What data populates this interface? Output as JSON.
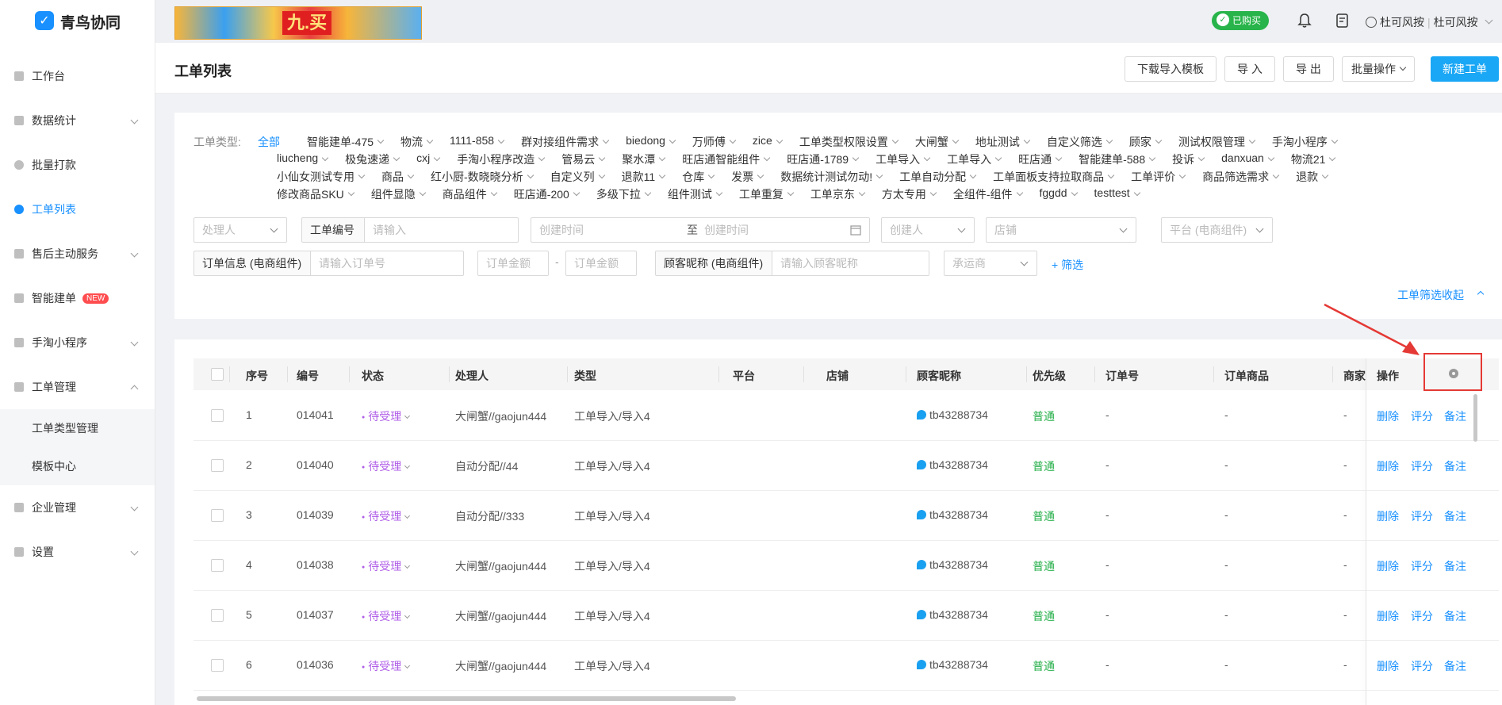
{
  "app": {
    "name": "青鸟协同",
    "logo_mark": "✓"
  },
  "banner": {
    "text": "九.买"
  },
  "header": {
    "purchased_label": "已购买",
    "user_name": "杜可风按",
    "company_name": "杜可风按",
    "separator": "|"
  },
  "sidebar": {
    "items": [
      {
        "label": "工作台",
        "icon": "workbench-icon"
      },
      {
        "label": "数据统计",
        "icon": "chart-icon"
      },
      {
        "label": "批量打款",
        "icon": "payment-icon"
      },
      {
        "label": "工单列表",
        "icon": "search-icon"
      },
      {
        "label": "售后主动服务",
        "icon": "service-icon"
      },
      {
        "label": "智能建单",
        "icon": "smart-icon",
        "badge": "NEW"
      },
      {
        "label": "手淘小程序",
        "icon": "miniapp-icon"
      },
      {
        "label": "工单管理",
        "icon": "ticket-icon"
      },
      {
        "label": "企业管理",
        "icon": "company-icon"
      },
      {
        "label": "设置",
        "icon": "settings-icon"
      }
    ],
    "sub_items": [
      "工单类型管理",
      "模板中心"
    ]
  },
  "page": {
    "title": "工单列表",
    "buttons": {
      "download_template": "下载导入模板",
      "import": "导 入",
      "export": "导 出",
      "batch": "批量操作",
      "create": "新建工单"
    }
  },
  "filters": {
    "type_label": "工单类型:",
    "type_rows": [
      [
        "全部",
        "智能建单-475",
        "物流",
        "1111-858",
        "群对接组件需求",
        "biedong",
        "万师傅",
        "zice",
        "工单类型权限设置",
        "大闸蟹",
        "地址测试",
        "自定义筛选",
        "顾家",
        "测试权限管理",
        "手淘小程序"
      ],
      [
        "liucheng",
        "极兔速递",
        "cxj",
        "手淘小程序改造",
        "管易云",
        "聚水潭",
        "旺店通智能组件",
        "旺店通-1789",
        "工单导入",
        "工单导入",
        "旺店通",
        "智能建单-588",
        "投诉",
        "danxuan",
        "物流21"
      ],
      [
        "小仙女测试专用",
        "商品",
        "红小厨-数晓晓分析",
        "自定义列",
        "退款11",
        "仓库",
        "发票",
        "数据统计测试勿动!",
        "工单自动分配",
        "工单面板支持拉取商品",
        "工单评价",
        "商品筛选需求",
        "退款"
      ],
      [
        "修改商品SKU",
        "组件显隐",
        "商品组件",
        "旺店通-200",
        "多级下拉",
        "组件测试",
        "工单重复",
        "工单京东",
        "方太专用",
        "全组件-组件",
        "fggdd",
        "testtest"
      ]
    ],
    "handler_placeholder": "处理人",
    "ticket_no_label": "工单编号",
    "ticket_no_placeholder": "请输入",
    "created_from_placeholder": "创建时间",
    "date_sep": "至",
    "created_to_placeholder": "创建时间",
    "creator_placeholder": "创建人",
    "shop_placeholder": "店铺",
    "platform_placeholder": "平台 (电商组件)",
    "order_label": "订单信息 (电商组件)",
    "order_placeholder": "请输入订单号",
    "amount_min_placeholder": "订单金额",
    "amount_sep": "-",
    "amount_max_placeholder": "订单金额",
    "buyer_label": "顾客昵称 (电商组件)",
    "buyer_placeholder": "请输入顾客昵称",
    "carrier_placeholder": "承运商",
    "add_filter": "+ 筛选",
    "collapse": "工单筛选收起"
  },
  "table": {
    "columns": [
      "序号",
      "编号",
      "状态",
      "处理人",
      "类型",
      "平台",
      "店铺",
      "顾客昵称",
      "优先级",
      "订单号",
      "订单商品",
      "商家",
      "操作"
    ],
    "rows": [
      {
        "index": "1",
        "no": "014041",
        "status": "待受理",
        "handler": "大闸蟹//gaojun444",
        "type": "工单导入/导入4",
        "buyer": "tb43288734",
        "priority": "普通",
        "order": "-",
        "goods": "-",
        "merchant": "-"
      },
      {
        "index": "2",
        "no": "014040",
        "status": "待受理",
        "handler": "自动分配//44",
        "type": "工单导入/导入4",
        "buyer": "tb43288734",
        "priority": "普通",
        "order": "-",
        "goods": "-",
        "merchant": "-"
      },
      {
        "index": "3",
        "no": "014039",
        "status": "待受理",
        "handler": "自动分配//333",
        "type": "工单导入/导入4",
        "buyer": "tb43288734",
        "priority": "普通",
        "order": "-",
        "goods": "-",
        "merchant": "-"
      },
      {
        "index": "4",
        "no": "014038",
        "status": "待受理",
        "handler": "大闸蟹//gaojun444",
        "type": "工单导入/导入4",
        "buyer": "tb43288734",
        "priority": "普通",
        "order": "-",
        "goods": "-",
        "merchant": "-"
      },
      {
        "index": "5",
        "no": "014037",
        "status": "待受理",
        "handler": "大闸蟹//gaojun444",
        "type": "工单导入/导入4",
        "buyer": "tb43288734",
        "priority": "普通",
        "order": "-",
        "goods": "-",
        "merchant": "-"
      },
      {
        "index": "6",
        "no": "014036",
        "status": "待受理",
        "handler": "大闸蟹//gaojun444",
        "type": "工单导入/导入4",
        "buyer": "tb43288734",
        "priority": "普通",
        "order": "-",
        "goods": "-",
        "merchant": "-"
      }
    ],
    "actions": [
      "删除",
      "评分",
      "备注"
    ]
  },
  "colors": {
    "accent": "#1890ff",
    "primary_button": "#1aa7f5",
    "status": "#b05ee8",
    "priority": "#27b04b",
    "highlight": "#e53935"
  }
}
